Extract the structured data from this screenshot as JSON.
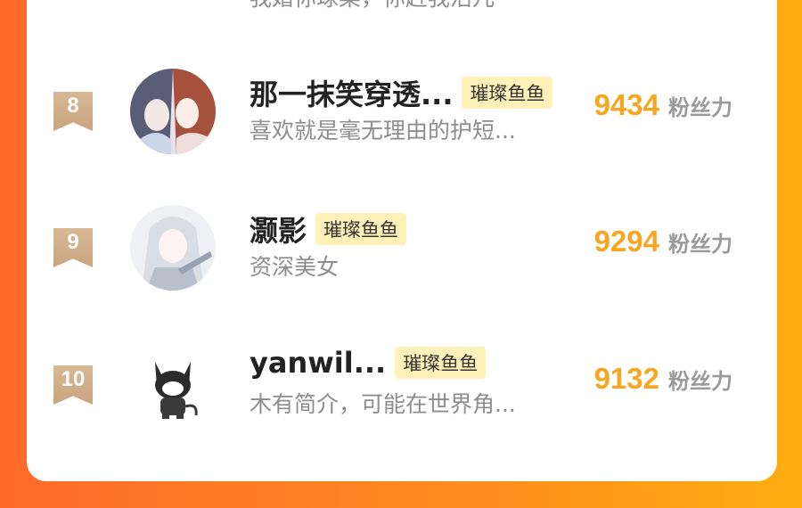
{
  "top_row": {
    "desc_partial": "我婚你球菜，你赶我活儿"
  },
  "rows": [
    {
      "rank": "8",
      "name": "那一抹笑穿透...",
      "tag": "璀璨鱼鱼",
      "desc": "喜欢就是毫无理由的护短...",
      "fans": "9434",
      "fans_label": "粉丝力",
      "avatar": "anime-couple-avatar"
    },
    {
      "rank": "9",
      "name": "灏影",
      "tag": "璀璨鱼鱼",
      "desc": "资深美女",
      "fans": "9294",
      "fans_label": "粉丝力",
      "avatar": "white-hair-character-avatar"
    },
    {
      "rank": "10",
      "name": "yanwil...",
      "tag": "璀璨鱼鱼",
      "desc": "木有简介，可能在世界角...",
      "fans": "9132",
      "fans_label": "粉丝力",
      "avatar": "black-cat-avatar"
    }
  ],
  "colors": {
    "accent": "#f5a623",
    "badge": "#c9a57f",
    "tag_bg": "#fff1b8",
    "background_left": "#ff6a2b",
    "background_right": "#ffad12"
  }
}
